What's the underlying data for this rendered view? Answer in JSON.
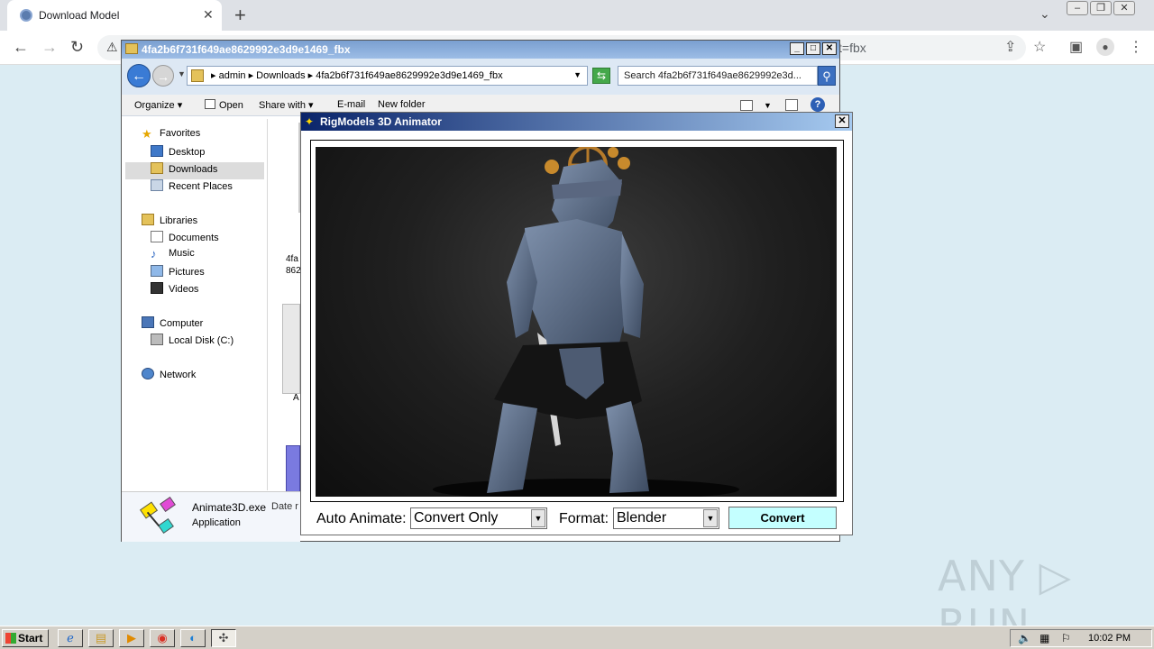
{
  "browser": {
    "tab_title": "Download Model",
    "url_tail": "t=fbx",
    "new_tab": "+",
    "tab_close": "✕",
    "tab_search": "⌄"
  },
  "explorer": {
    "title": "4fa2b6f731f649ae8629992e3d9e1469_fbx",
    "breadcrumbs": "▸ admin ▸ Downloads ▸ 4fa2b6f731f649ae8629992e3d9e1469_fbx",
    "search_placeholder": "Search 4fa2b6f731f649ae8629992e3d...",
    "commands": {
      "organize": "Organize",
      "open": "Open",
      "share_with": "Share with",
      "email": "E-mail",
      "new_folder": "New folder"
    },
    "nav": {
      "favorites": "Favorites",
      "desktop": "Desktop",
      "downloads": "Downloads",
      "recent_places": "Recent Places",
      "libraries": "Libraries",
      "documents": "Documents",
      "music": "Music",
      "pictures": "Pictures",
      "videos": "Videos",
      "computer": "Computer",
      "local_disk": "Local Disk (C:)",
      "network": "Network"
    },
    "content": {
      "file_name_part1": "4fa",
      "file_name_part2": "862",
      "file_label_part": "A"
    },
    "details": {
      "name": "Animate3D.exe",
      "date_label": "Date r",
      "type": "Application"
    }
  },
  "dialog": {
    "title": "RigModels 3D Animator",
    "auto_animate_label": "Auto Animate:",
    "auto_animate_value": "Convert Only",
    "format_label": "Format:",
    "format_value": "Blender",
    "convert_label": "Convert"
  },
  "watermark": "ANY ▷ RUN",
  "taskbar": {
    "start": "Start",
    "clock": "10:02 PM"
  }
}
